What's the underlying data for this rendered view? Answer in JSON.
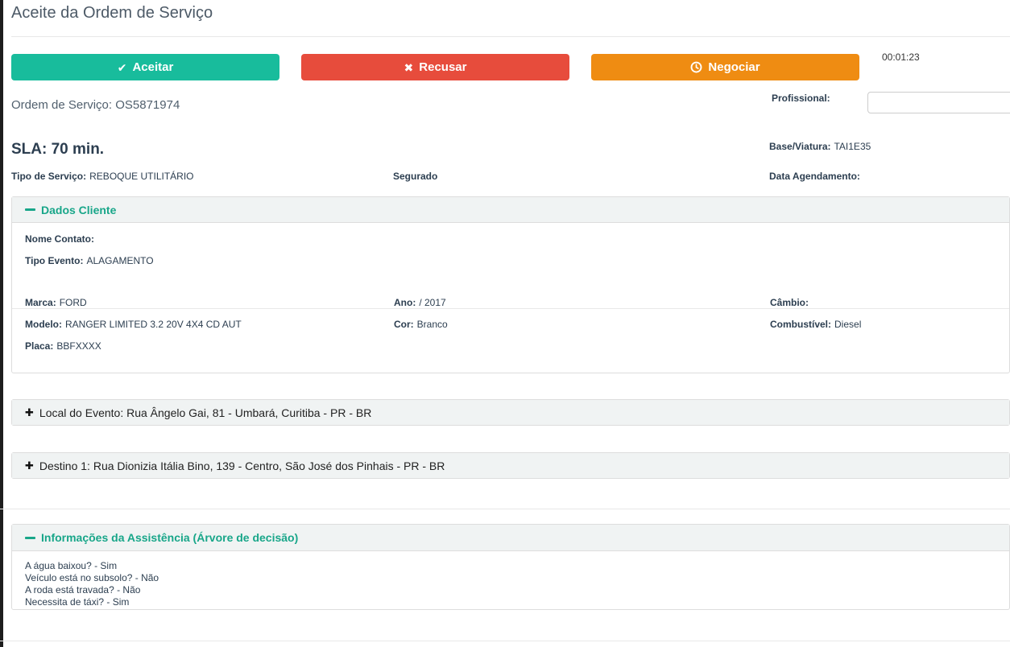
{
  "page": {
    "title": "Aceite da Ordem de Serviço"
  },
  "actions": {
    "accept_label": "Aceitar",
    "refuse_label": "Recusar",
    "negotiate_label": "Negociar",
    "timer": "00:01:23"
  },
  "order": {
    "order_line": "Ordem de Serviço: OS5871974",
    "professional_label": "Profissional:",
    "professional_value": "",
    "sla": "SLA: 70 min.",
    "base_viatura_label": "Base/Viatura:",
    "base_viatura_value": "TAI1E35",
    "tipo_servico_label": "Tipo de Serviço:",
    "tipo_servico_value": "REBOQUE UTILITÁRIO",
    "segurado_label": "Segurado",
    "data_agendamento_label": "Data Agendamento:",
    "data_agendamento_value": ""
  },
  "dados_cliente": {
    "title": "Dados Cliente",
    "nome_contato_label": "Nome Contato:",
    "nome_contato_value": "",
    "tipo_evento_label": "Tipo Evento:",
    "tipo_evento_value": "ALAGAMENTO",
    "marca_label": "Marca:",
    "marca_value": "FORD",
    "ano_label": "Ano:",
    "ano_value": "/ 2017",
    "cambio_label": "Câmbio:",
    "cambio_value": "",
    "modelo_label": "Modelo:",
    "modelo_value": "RANGER LIMITED 3.2 20V 4X4 CD AUT",
    "cor_label": "Cor:",
    "cor_value": "Branco",
    "combustivel_label": "Combustível:",
    "combustivel_value": "Diesel",
    "placa_label": "Placa:",
    "placa_value": "BBFXXXX"
  },
  "local_evento": {
    "title": "Local do Evento: Rua Ângelo Gai, 81 - Umbará, Curitiba - PR - BR"
  },
  "destino1": {
    "title": "Destino 1: Rua Dionizia Itália Bino, 139 - Centro, São José dos Pinhais - PR - BR"
  },
  "assistencia": {
    "title": "Informações da Assistência (Árvore de decisão)",
    "lines": [
      "A água baixou? - Sim",
      "Veículo está no subsolo? - Não",
      "A roda está travada? - Não",
      "Necessita de táxi? - Sim"
    ]
  },
  "icons": {
    "accept": "check-icon",
    "refuse": "x-icon",
    "negotiate": "clock-icon",
    "collapse": "minus-icon",
    "expand": "plus-icon"
  },
  "colors": {
    "success": "#18bc9c",
    "danger": "#e74c3c",
    "warning": "#ef8c12",
    "panel_title_teal": "#18a689",
    "title_text": "#4d5a67",
    "label_text": "#2c3e50"
  }
}
